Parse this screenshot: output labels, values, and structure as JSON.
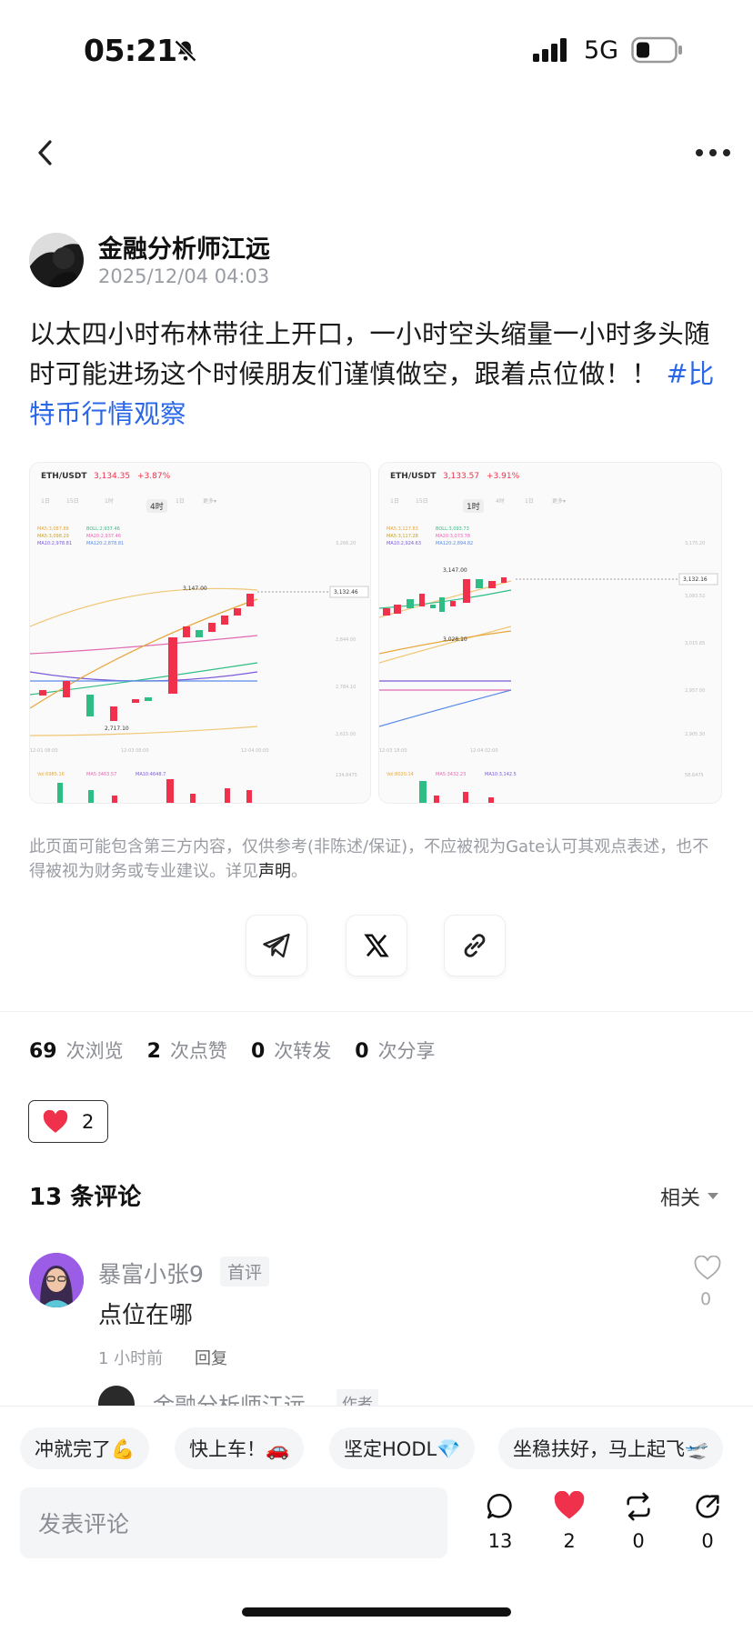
{
  "status_bar": {
    "time": "05:21",
    "network": "5G"
  },
  "author": {
    "name": "金融分析师江远",
    "timestamp": "2025/12/04 04:03"
  },
  "post": {
    "text": "以太四小时布林带往上开口，一小时空头缩量一小时多头随时可能进场这个时候朋友们谨慎做空，跟着点位做！！",
    "hashtag": "#比特币行情观察"
  },
  "chart_images": [
    {
      "pair": "ETH/USDT",
      "price": "3,134.35",
      "change": "+3.87%",
      "interval": "4时",
      "last_price": "3,132.46",
      "high_label": "3,147.00",
      "low_label": "2,717.10"
    },
    {
      "pair": "ETH/USDT",
      "price": "3,133.57",
      "change": "+3.91%",
      "interval": "1时",
      "last_price": "3,132.16",
      "high_label": "3,147.00",
      "low_label": "3,028.10"
    }
  ],
  "disclaimer": {
    "text": "此页面可能包含第三方内容，仅供参考(非陈述/保证)，不应被视为Gate认可其观点表述，也不得被视为财务或专业建议。详见",
    "link": "声明",
    "end": "。"
  },
  "stats": [
    {
      "value": "69",
      "label": "次浏览"
    },
    {
      "value": "2",
      "label": "次点赞"
    },
    {
      "value": "0",
      "label": "次转发"
    },
    {
      "value": "0",
      "label": "次分享"
    }
  ],
  "like_chip": {
    "count": "2"
  },
  "comments": {
    "title": "13 条评论",
    "sort": "相关",
    "items": [
      {
        "name": "暴富小张9",
        "badge": "首评",
        "text": "点位在哪",
        "time": "1 小时前",
        "reply": "回复",
        "likes": "0"
      }
    ],
    "peek_name": "金融分析师江远",
    "peek_badge": "作者"
  },
  "quick_replies": [
    "冲就完了💪",
    "快上车！🚗",
    "坚定HODL💎",
    "坐稳扶好，马上起飞🛫"
  ],
  "bottom_bar": {
    "input_placeholder": "发表评论",
    "comment_count": "13",
    "like_count": "2",
    "repost_count": "0",
    "share_count": "0"
  },
  "colors": {
    "accent_link": "#2a67e8",
    "like_red": "#f0314c",
    "up_green": "#2ebd85",
    "down_red": "#f0314c"
  }
}
